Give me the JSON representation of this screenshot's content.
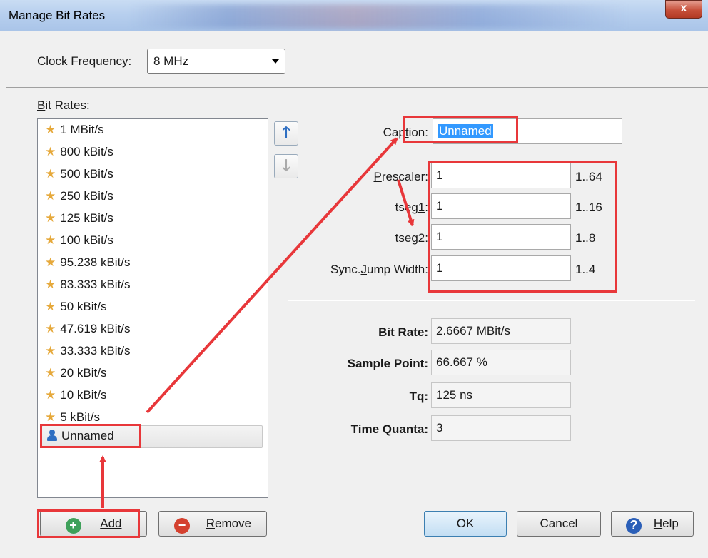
{
  "window": {
    "title": "Manage Bit Rates",
    "close_glyph": "x"
  },
  "clock": {
    "label_prefix": "C",
    "label_rest": "lock Frequency:",
    "value": "8 MHz"
  },
  "bitrates": {
    "label_prefix": "B",
    "label_rest": "it Rates:",
    "items": [
      "1 MBit/s",
      "800 kBit/s",
      "500 kBit/s",
      "250 kBit/s",
      "125 kBit/s",
      "100 kBit/s",
      "95.238 kBit/s",
      "83.333 kBit/s",
      "50 kBit/s",
      "47.619 kBit/s",
      "33.333 kBit/s",
      "20 kBit/s",
      "10 kBit/s",
      "5 kBit/s"
    ],
    "custom_item": "Unnamed",
    "item_icon": "star-icon",
    "custom_icon": "user-icon"
  },
  "move": {
    "up_icon": "arrow-up-icon",
    "down_icon": "arrow-down-icon"
  },
  "fields": {
    "caption": {
      "label_a": "Cap",
      "label_u": "t",
      "label_b": "ion:",
      "value": "Unnamed"
    },
    "prescaler": {
      "label_u": "P",
      "label_b": "rescaler:",
      "value": "1",
      "range": "1..64"
    },
    "tseg1": {
      "label_a": "tseg",
      "label_u": "1",
      "label_b": ":",
      "value": "1",
      "range": "1..16"
    },
    "tseg2": {
      "label_a": "tseg",
      "label_u": "2",
      "label_b": ":",
      "value": "1",
      "range": "1..8"
    },
    "sjw": {
      "label_a": "Sync.",
      "label_u": "J",
      "label_b": "ump Width:",
      "value": "1",
      "range": "1..4"
    }
  },
  "results": {
    "bit_rate": {
      "label": "Bit Rate:",
      "value": "2.6667 MBit/s"
    },
    "sample_point": {
      "label": "Sample Point:",
      "value": "66.667 %"
    },
    "tq": {
      "label": "Tq:",
      "value": "125 ns"
    },
    "time_quanta": {
      "label": "Time Quanta:",
      "value": "3"
    }
  },
  "buttons": {
    "add": "Add",
    "remove_u": "R",
    "remove_rest": "emove",
    "ok": "OK",
    "cancel": "Cancel",
    "help_u": "H",
    "help_rest": "elp",
    "add_glyph": "+",
    "remove_glyph": "−",
    "help_glyph": "?"
  },
  "colors": {
    "annotation": "#e8373a",
    "star": "#e6a93b",
    "selection": "#3399ff"
  }
}
